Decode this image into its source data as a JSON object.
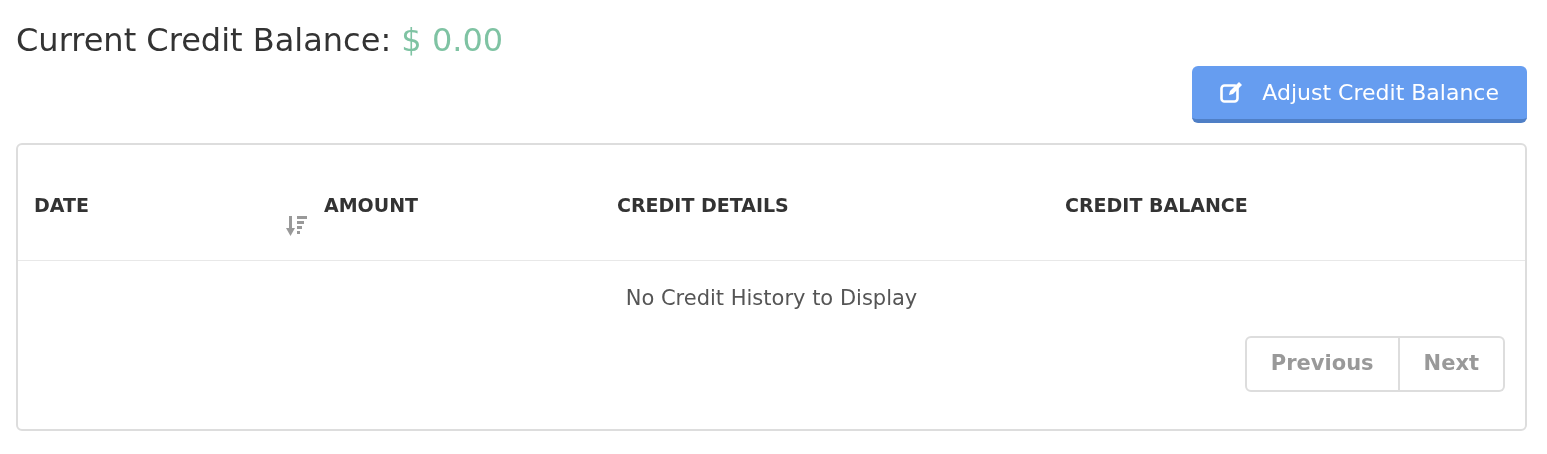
{
  "balance": {
    "label": "Current Credit Balance:",
    "amount": "$ 0.00"
  },
  "adjust_button": {
    "label": "Adjust Credit Balance"
  },
  "table": {
    "columns": [
      {
        "label": "DATE",
        "sorted": true
      },
      {
        "label": "AMOUNT",
        "sorted": false
      },
      {
        "label": "CREDIT DETAILS",
        "sorted": false
      },
      {
        "label": "CREDIT BALANCE",
        "sorted": false
      }
    ],
    "empty_message": "No Credit History to Display"
  },
  "pagination": [
    {
      "label": "Previous",
      "disabled": true
    },
    {
      "label": "Next",
      "disabled": true
    }
  ]
}
